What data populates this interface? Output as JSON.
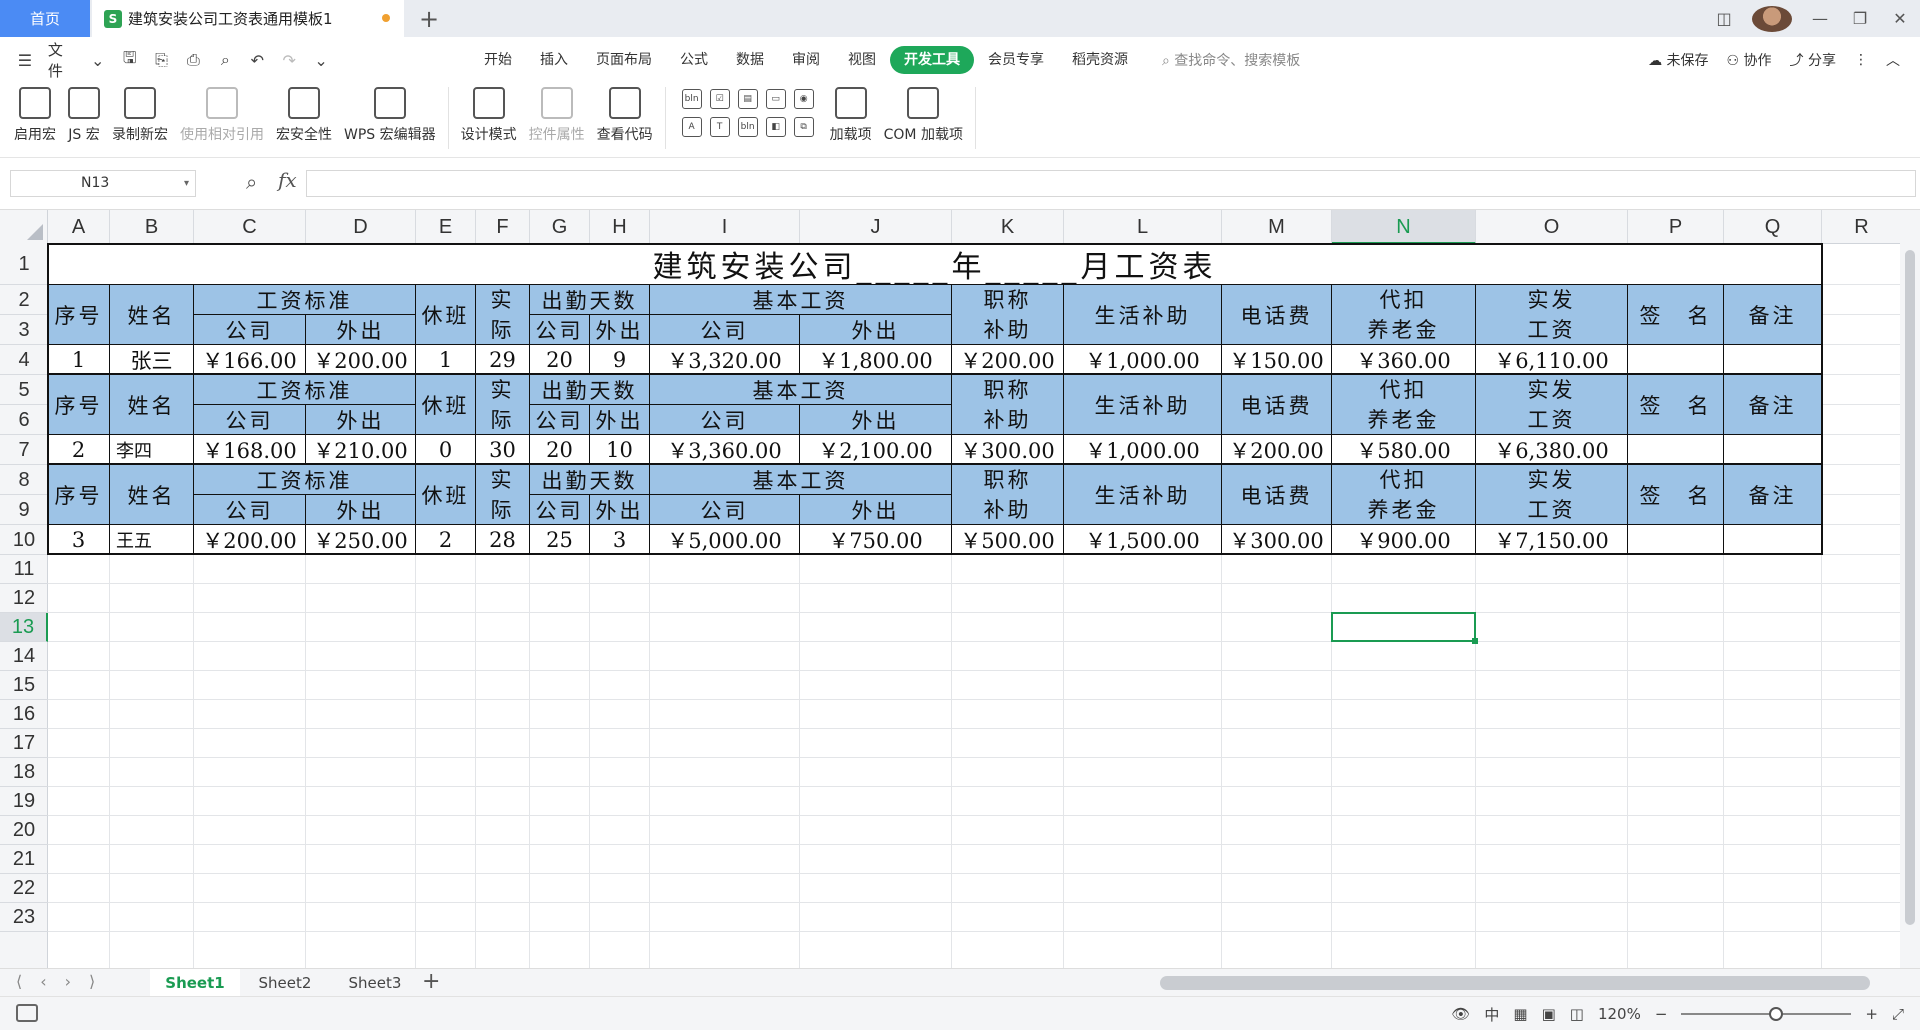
{
  "tabs": {
    "home": "首页",
    "doc_title": "建筑安装公司工资表通用模板1",
    "doc_icon": "S"
  },
  "menubar": {
    "file": "文件",
    "menus": [
      "开始",
      "插入",
      "页面布局",
      "公式",
      "数据",
      "审阅",
      "视图",
      "开发工具",
      "会员专享",
      "稻壳资源"
    ],
    "active_menu": "开发工具",
    "search_placeholder": "查找命令、搜索模板",
    "unsaved": "未保存",
    "collab": "协作",
    "share": "分享"
  },
  "ribbon": {
    "buttons": [
      "启用宏",
      "JS 宏",
      "录制新宏",
      "使用相对引用",
      "宏安全性",
      "WPS 宏编辑器",
      "设计模式",
      "控件属性",
      "查看代码",
      "加载项",
      "COM 加载项"
    ],
    "controls": [
      "bln",
      "☑",
      "▤",
      "▭",
      "◉",
      "A",
      "T",
      "bln",
      "◧",
      "⧉"
    ]
  },
  "formula_bar": {
    "name_box": "N13",
    "fx": "fx",
    "value": ""
  },
  "columns": [
    "A",
    "B",
    "C",
    "D",
    "E",
    "F",
    "G",
    "H",
    "I",
    "J",
    "K",
    "L",
    "M",
    "N",
    "O",
    "P",
    "Q",
    "R"
  ],
  "selected_column": "N",
  "rows": [
    "1",
    "2",
    "3",
    "4",
    "5",
    "6",
    "7",
    "8",
    "9",
    "10",
    "11",
    "12",
    "13",
    "14",
    "15",
    "16",
    "17",
    "18",
    "19",
    "20",
    "21",
    "22",
    "23"
  ],
  "selected_row": "13",
  "sheet": {
    "title": "建筑安装公司_____年_____月工资表",
    "headers": {
      "seq": "序号",
      "name": "姓名",
      "wage_std": "工资标准",
      "company": "公司",
      "outside": "外出",
      "rest": "休班",
      "actual_1": "实",
      "actual_2": "际",
      "attendance": "出勤天数",
      "basic_wage": "基本工资",
      "title_allow_1": "职称",
      "title_allow_2": "补助",
      "living": "生活补助",
      "phone": "电话费",
      "pension_1": "代扣",
      "pension_2": "养老金",
      "net_1": "实发",
      "net_2": "工资",
      "sign": "签　名",
      "remark": "备注"
    },
    "records": [
      {
        "seq": "1",
        "name": "张三",
        "std_company": "￥166.00",
        "std_outside": "￥200.00",
        "rest": "1",
        "actual": "29",
        "att_company": "20",
        "att_outside": "9",
        "basic_company": "￥3,320.00",
        "basic_outside": "￥1,800.00",
        "title_allow": "￥200.00",
        "living": "￥1,000.00",
        "phone": "￥150.00",
        "pension": "￥360.00",
        "net": "￥6,110.00",
        "sign": "",
        "remark": ""
      },
      {
        "seq": "2",
        "name": "李四",
        "std_company": "￥168.00",
        "std_outside": "￥210.00",
        "rest": "0",
        "actual": "30",
        "att_company": "20",
        "att_outside": "10",
        "basic_company": "￥3,360.00",
        "basic_outside": "￥2,100.00",
        "title_allow": "￥300.00",
        "living": "￥1,000.00",
        "phone": "￥200.00",
        "pension": "￥580.00",
        "net": "￥6,380.00",
        "sign": "",
        "remark": ""
      },
      {
        "seq": "3",
        "name": "王五",
        "std_company": "￥200.00",
        "std_outside": "￥250.00",
        "rest": "2",
        "actual": "28",
        "att_company": "25",
        "att_outside": "3",
        "basic_company": "￥5,000.00",
        "basic_outside": "￥750.00",
        "title_allow": "￥500.00",
        "living": "￥1,500.00",
        "phone": "￥300.00",
        "pension": "￥900.00",
        "net": "￥7,150.00",
        "sign": "",
        "remark": ""
      }
    ]
  },
  "sheets": [
    "Sheet1",
    "Sheet2",
    "Sheet3"
  ],
  "active_sheet": "Sheet1",
  "status": {
    "zoom": "120%"
  },
  "colors": {
    "accent": "#1a9b52",
    "header_fill": "#9dc3e6",
    "home_tab": "#4b8bf4"
  }
}
